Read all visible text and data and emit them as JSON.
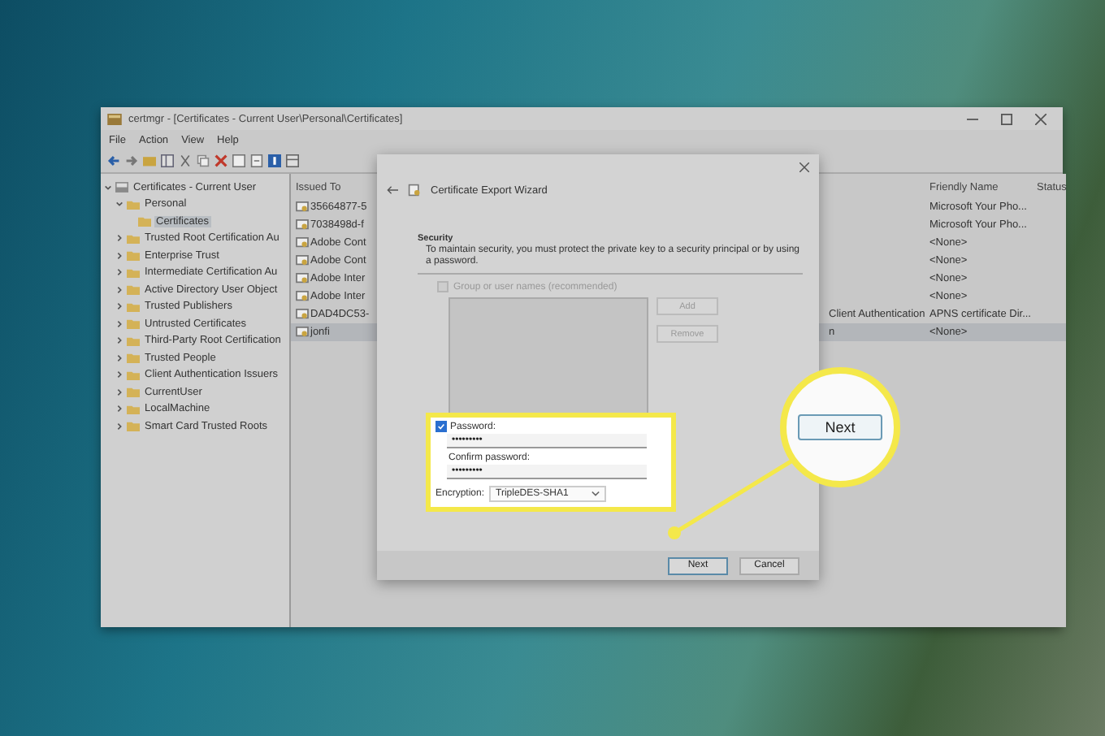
{
  "window": {
    "title": "certmgr - [Certificates - Current User\\Personal\\Certificates]"
  },
  "menu": [
    "File",
    "Action",
    "View",
    "Help"
  ],
  "tree": [
    {
      "label": "Certificates - Current User",
      "expanded": true,
      "selected": false,
      "children": [
        {
          "label": "Personal",
          "expanded": true,
          "selected": false,
          "children": [
            {
              "label": "Certificates",
              "selected": true
            }
          ]
        },
        {
          "label": "Trusted Root Certification Au",
          "expanded": false,
          "selected": false
        },
        {
          "label": "Enterprise Trust",
          "expanded": false,
          "selected": false
        },
        {
          "label": "Intermediate Certification Au",
          "expanded": false,
          "selected": false
        },
        {
          "label": "Active Directory User Object",
          "expanded": false,
          "selected": false
        },
        {
          "label": "Trusted Publishers",
          "expanded": false,
          "selected": false
        },
        {
          "label": "Untrusted Certificates",
          "expanded": false,
          "selected": false
        },
        {
          "label": "Third-Party Root Certification",
          "expanded": false,
          "selected": false
        },
        {
          "label": "Trusted People",
          "expanded": false,
          "selected": false
        },
        {
          "label": "Client Authentication Issuers",
          "expanded": false,
          "selected": false
        },
        {
          "label": "CurrentUser",
          "expanded": false,
          "selected": false
        },
        {
          "label": "LocalMachine",
          "expanded": false,
          "selected": false
        },
        {
          "label": "Smart Card Trusted Roots",
          "expanded": false,
          "selected": false
        }
      ]
    }
  ],
  "table": {
    "columns": {
      "issued_to": "Issued To",
      "friendly_name": "Friendly Name",
      "status": "Status"
    },
    "rows": [
      {
        "issued_to": "35664877-5",
        "friendly_name": "Microsoft Your Pho...",
        "selected": false
      },
      {
        "issued_to": "7038498d-f",
        "friendly_name": "Microsoft Your Pho...",
        "selected": false
      },
      {
        "issued_to": "Adobe Cont",
        "friendly_name": "<None>",
        "selected": false
      },
      {
        "issued_to": "Adobe Cont",
        "friendly_name": "<None>",
        "selected": false
      },
      {
        "issued_to": "Adobe Inter",
        "friendly_name": "<None>",
        "selected": false
      },
      {
        "issued_to": "Adobe Inter",
        "friendly_name": "<None>",
        "selected": false
      },
      {
        "issued_to": "DAD4DC53-",
        "column_2": "Client Authentication",
        "friendly_name": "APNS certificate Dir...",
        "selected": false
      },
      {
        "issued_to": "jonfi",
        "column_2": "n",
        "friendly_name": "<None>",
        "selected": true
      }
    ]
  },
  "dialog": {
    "title": "Certificate Export Wizard",
    "heading": "Security",
    "description": "To maintain security, you must protect the private key to a security principal or by using a password.",
    "group_checkbox": {
      "label": "Group or user names (recommended)",
      "checked": false,
      "disabled": true
    },
    "side_buttons": [
      {
        "label": "Add",
        "disabled": true
      },
      {
        "label": "Remove",
        "disabled": true
      }
    ],
    "password_checkbox": {
      "label": "Password:",
      "checked": true
    },
    "password": {
      "value": "•••••••••"
    },
    "confirm": {
      "label": "Confirm password:",
      "value": "•••••••••"
    },
    "encryption": {
      "label": "Encryption:",
      "value": "TripleDES-SHA1"
    },
    "buttons": [
      {
        "label": "Next",
        "kind": "primary"
      },
      {
        "label": "Cancel",
        "kind": "normal"
      }
    ]
  },
  "callout": {
    "label": "Next"
  }
}
